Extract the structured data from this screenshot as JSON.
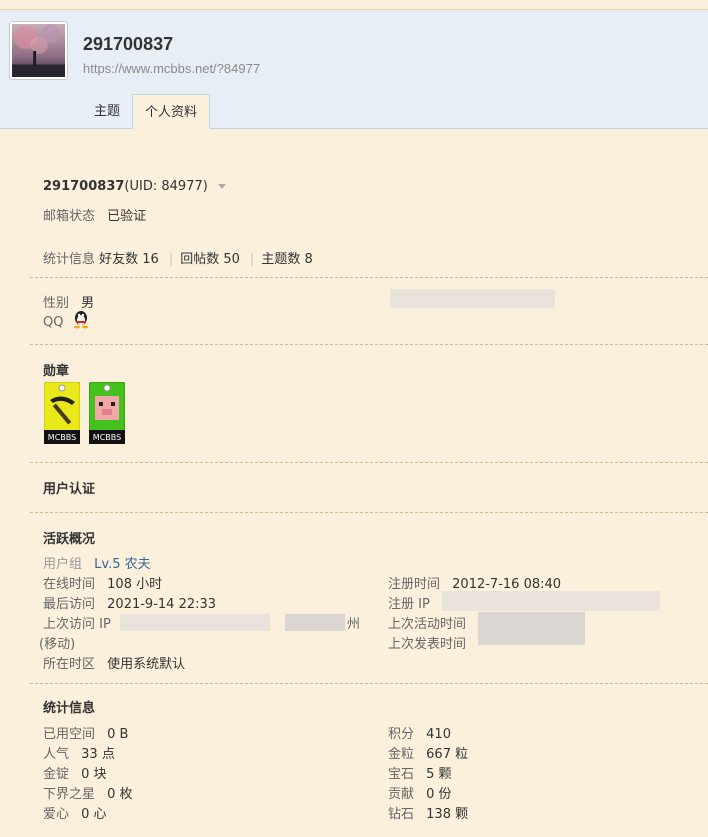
{
  "header": {
    "username": "291700837",
    "url": "https://www.mcbbs.net/?84977",
    "tabs": [
      {
        "label": "主题",
        "active": false
      },
      {
        "label": "个人资料",
        "active": true
      }
    ]
  },
  "profile": {
    "name": "291700837",
    "uid_text": "(UID: 84977)",
    "email_label": "邮箱状态",
    "email_value": "已验证",
    "stats_label": "统计信息",
    "friends": "好友数 16",
    "replies": "回帖数 50",
    "threads": "主题数 8"
  },
  "basic": {
    "gender_label": "性别",
    "gender_value": "男",
    "qq_label": "QQ"
  },
  "medals": {
    "title": "勋章",
    "items": [
      {
        "icon": "pickaxe-badge-icon",
        "text": "MCBBS",
        "color": "#e8e81a"
      },
      {
        "icon": "pig-badge-icon",
        "text": "MCBBS",
        "color": "#45c21d"
      }
    ]
  },
  "verify": {
    "title": "用户认证"
  },
  "activity": {
    "title": "活跃概况",
    "group_label": "用户组",
    "group_value": "Lv.5 农夫",
    "online_label": "在线时间",
    "online_value": "108 小时",
    "reg_time_label": "注册时间",
    "reg_time_value": "2012-7-16 08:40",
    "last_visit_label": "最后访问",
    "last_visit_value": "2021-9-14 22:33",
    "reg_ip_label": "注册 IP",
    "last_ip_label": "上次访问 IP",
    "last_ip_suffix": "州",
    "last_ip_carrier": "(移动)",
    "last_active_label": "上次活动时间",
    "last_post_label": "上次发表时间",
    "tz_label": "所在时区",
    "tz_value": "使用系统默认"
  },
  "stats": {
    "title": "统计信息",
    "left": [
      {
        "label": "已用空间",
        "value": "0 B"
      },
      {
        "label": "人气",
        "value": "33 点"
      },
      {
        "label": "金锭",
        "value": "0 块"
      },
      {
        "label": "下界之星",
        "value": "0 枚"
      },
      {
        "label": "爱心",
        "value": "0 心"
      }
    ],
    "right": [
      {
        "label": "积分",
        "value": "410"
      },
      {
        "label": "金粒",
        "value": "667 粒"
      },
      {
        "label": "宝石",
        "value": "5 颗"
      },
      {
        "label": "贡献",
        "value": "0 份"
      },
      {
        "label": "钻石",
        "value": "138 颗"
      }
    ]
  }
}
